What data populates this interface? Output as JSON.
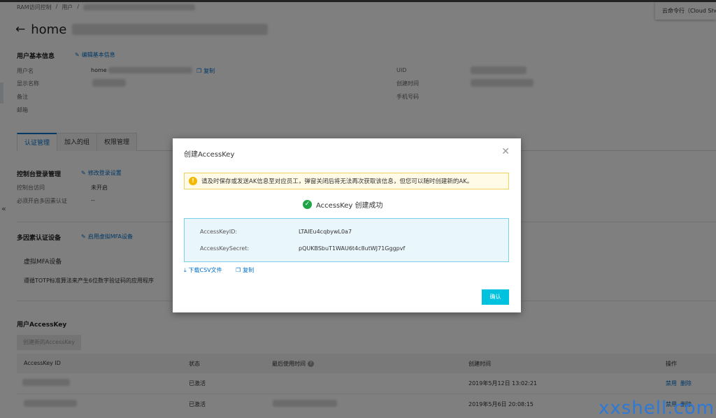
{
  "breadcrumb": [
    "RAM访问控制",
    "/",
    "用户",
    "/"
  ],
  "page": {
    "title": "home"
  },
  "basic_info": {
    "section_title": "用户基本信息",
    "edit_link": "编辑基本信息",
    "fields": {
      "username_label": "用户名",
      "username_value": "home",
      "copy_label": "复制",
      "display_name_label": "显示名称",
      "remark_label": "备注",
      "email_label": "邮箱",
      "uid_label": "UID",
      "created_label": "创建时间",
      "phone_label": "手机号码"
    }
  },
  "tabs": [
    "认证管理",
    "加入的组",
    "权限管理"
  ],
  "console_login": {
    "section_title": "控制台登录管理",
    "edit_link": "修改登录设置",
    "access_label": "控制台访问",
    "access_value": "未开启",
    "mfa_required_label": "必须开启多因素认证",
    "mfa_required_value": "--"
  },
  "mfa": {
    "section_title": "多因素认证设备",
    "enable_link": "启用虚拟MFA设备",
    "device_title": "虚拟MFA设备",
    "device_desc": "遵循TOTP标准算法来产生6位数字验证码的应用程序"
  },
  "access_keys": {
    "section_title": "用户AccessKey",
    "create_button": "创建新的AccessKey",
    "columns": [
      "AccessKey ID",
      "状态",
      "最后使用时间",
      "创建时间",
      "操作"
    ],
    "rows": [
      {
        "status": "已激活",
        "created": "2019年5月12日 13:02:21",
        "disable": "禁用",
        "delete": "删除"
      },
      {
        "status": "已激活",
        "created": "2019年5月6日 20:08:15",
        "disable": "禁用",
        "delete": "删除"
      }
    ]
  },
  "tooltip": {
    "text": "云命令行（Cloud Shell）"
  },
  "modal": {
    "title": "创建AccessKey",
    "warning": "请及时保存或发送AK信息至对应员工，弹窗关闭后将无法再次获取该信息，但您可以随时创建新的AK。",
    "success": "AccessKey 创建成功",
    "key_id_label": "AccessKeyID:",
    "key_id_value": "LTAIEu4cqbywL0a7",
    "key_secret_label": "AccessKeySecret:",
    "key_secret_value": "pQUKBSbuT1WAU6t4c8utWJ71Gggpvf",
    "download_link": "下载CSV文件",
    "copy_link": "复制",
    "confirm_button": "确认"
  },
  "watermark": "xxshell.com",
  "colors": {
    "accent": "#0070cc",
    "confirm": "#00c1de",
    "success": "#1fa446",
    "warning": "#f5b800"
  }
}
